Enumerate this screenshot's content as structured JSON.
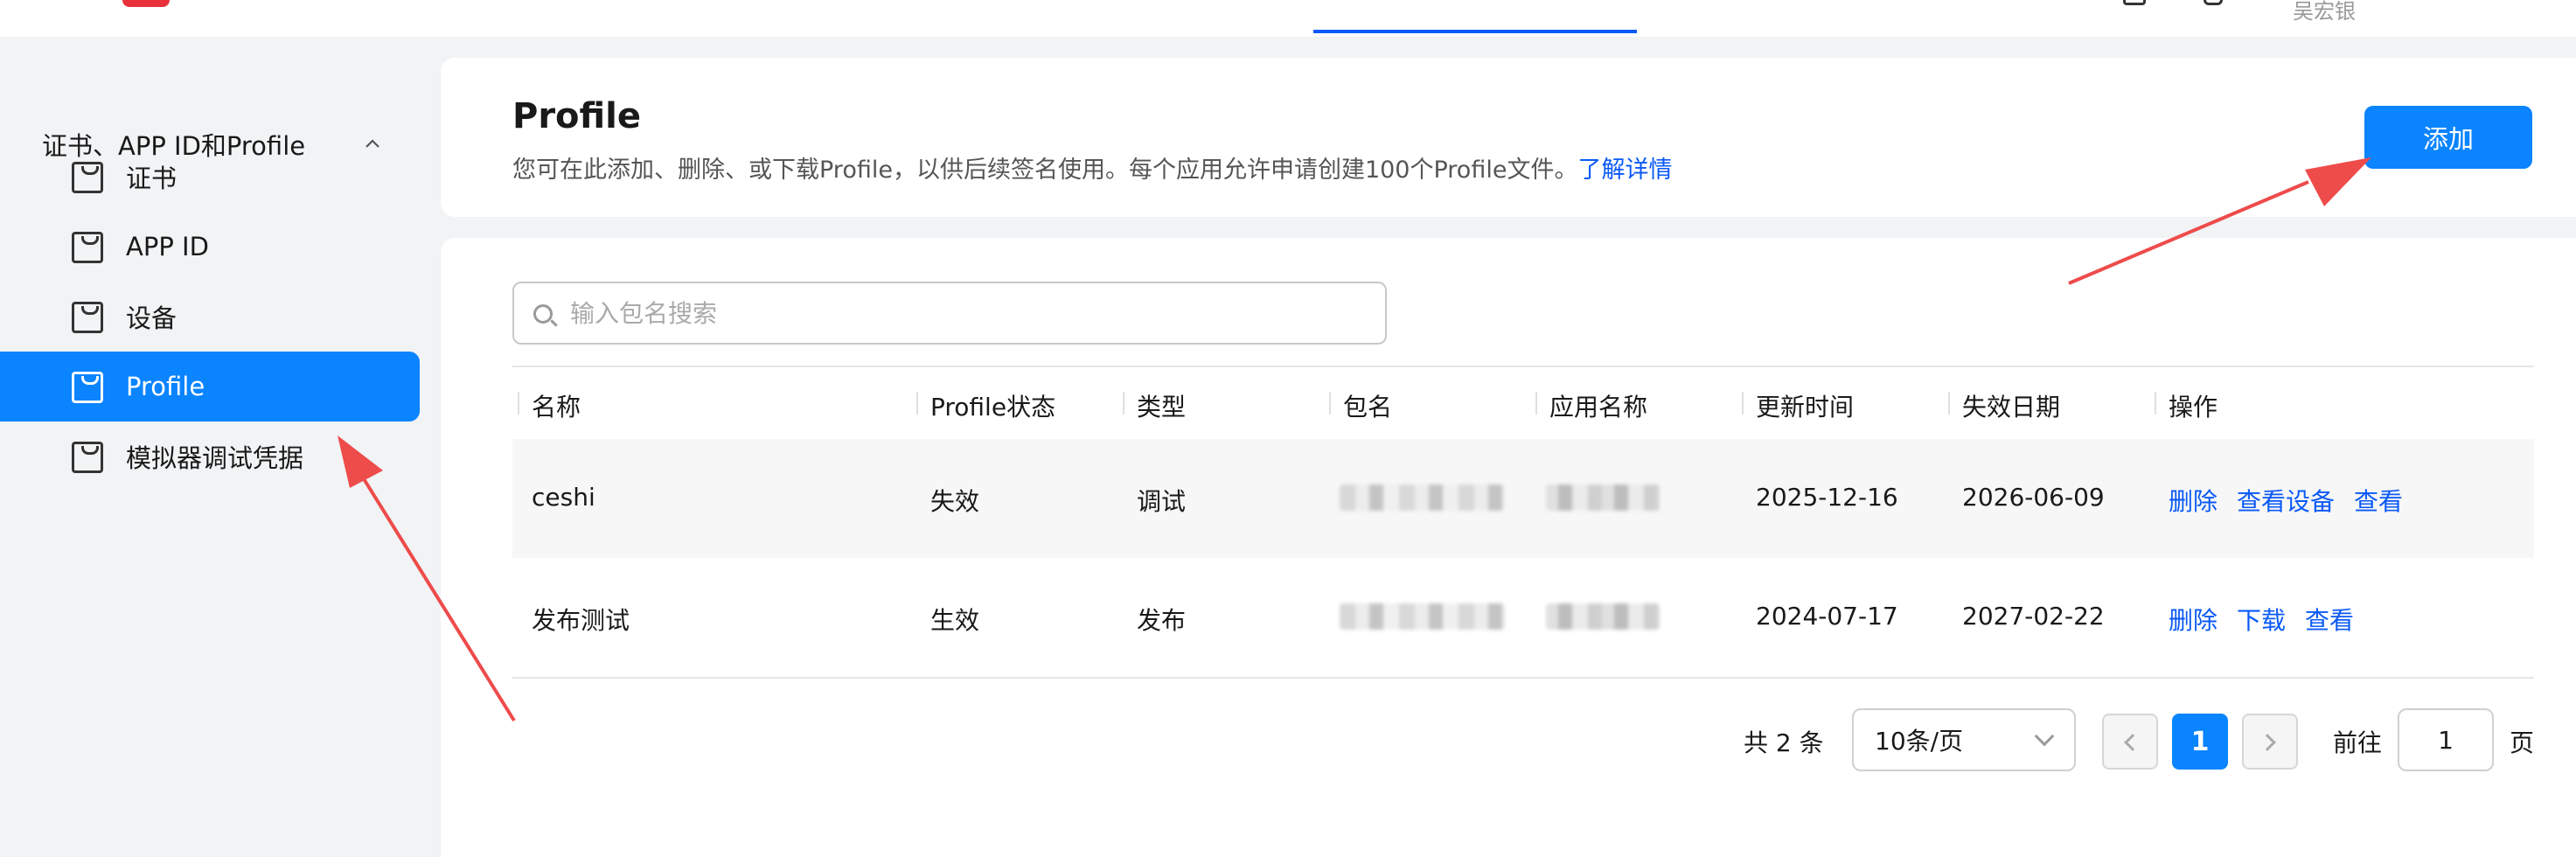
{
  "topbar": {
    "user_name": "吴宏银"
  },
  "sidebar": {
    "group_label": "证书、APP ID和Profile",
    "items": [
      {
        "label": "证书"
      },
      {
        "label": "APP ID"
      },
      {
        "label": "设备"
      },
      {
        "label": "Profile",
        "active": true
      },
      {
        "label": "模拟器调试凭据"
      }
    ]
  },
  "header": {
    "title": "Profile",
    "description": "您可在此添加、删除、或下载Profile，以供后续签名使用。每个应用允许申请创建100个Profile文件。",
    "learn_more": "了解详情",
    "add_button": "添加"
  },
  "search": {
    "placeholder": "输入包名搜索",
    "value": ""
  },
  "table": {
    "columns": [
      "名称",
      "Profile状态",
      "类型",
      "包名",
      "应用名称",
      "更新时间",
      "失效日期",
      "操作"
    ],
    "rows": [
      {
        "name": "ceshi",
        "status": "失效",
        "type": "调试",
        "updated": "2025-12-16",
        "expires": "2026-06-09",
        "actions": [
          "删除",
          "查看设备",
          "查看"
        ]
      },
      {
        "name": "发布测试",
        "status": "生效",
        "type": "发布",
        "updated": "2024-07-17",
        "expires": "2027-02-22",
        "actions": [
          "删除",
          "下载",
          "查看"
        ]
      }
    ]
  },
  "pagination": {
    "total": "共 2 条",
    "page_size": "10条/页",
    "current_page": "1",
    "goto_label": "前往",
    "goto_value": "1",
    "goto_suffix": "页"
  },
  "colors": {
    "accent": "#0a84ff",
    "link": "#0a59f7",
    "annotation": "#ee4b4b"
  }
}
